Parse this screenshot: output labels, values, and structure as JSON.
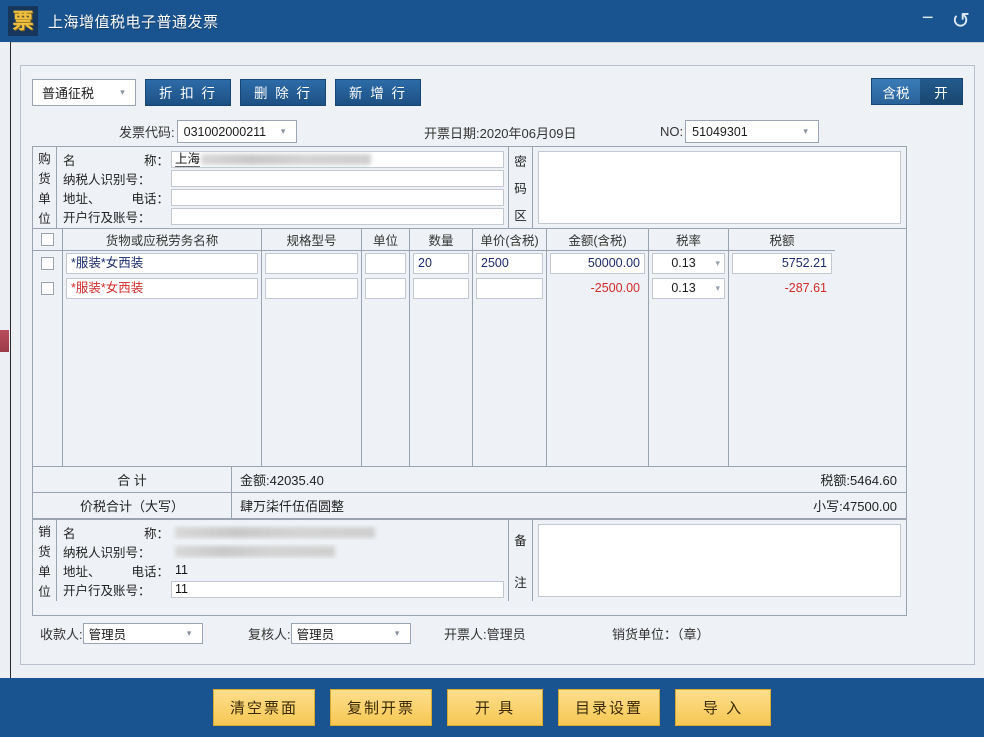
{
  "window": {
    "logo_glyph": "票",
    "title": "上海增值税电子普通发票",
    "minimize_glyph": "−",
    "restore_glyph": "↺"
  },
  "toolbar": {
    "tax_type": "普通征税",
    "caret": "▾",
    "discount_row": "折 扣 行",
    "delete_row": "删 除 行",
    "add_row": "新 增 行",
    "tax_included": "含税",
    "open": "开"
  },
  "header": {
    "code_label": "发票代码:",
    "code_value": "031002000211",
    "date_text": "开票日期:2020年06月09日",
    "no_label": "NO:",
    "no_value": "51049301"
  },
  "buyer": {
    "vertical": [
      "购",
      "货",
      "单",
      "位"
    ],
    "name_label_a": "名",
    "name_label_b": "称：",
    "name_value": "上海",
    "taxid_label": "纳税人识别号：",
    "taxid_value": "",
    "addr_label_a": "地址、",
    "addr_label_b": "电话：",
    "addr_value": "",
    "bank_label": "开户行及账号：",
    "bank_value": "",
    "secret_vertical": [
      "密",
      "码",
      "区"
    ],
    "secret_value": ""
  },
  "items": {
    "columns": [
      "货物或应税劳务名称",
      "规格型号",
      "单位",
      "数量",
      "单价(含税)",
      "金额(含税)",
      "税率",
      "税额"
    ],
    "rows": [
      {
        "name": "*服装*女西装",
        "spec": "",
        "unit": "",
        "qty": "20",
        "price": "2500",
        "amount": "50000.00",
        "rate": "0.13",
        "tax": "5752.21",
        "negative": false
      },
      {
        "name": "*服装*女西装",
        "spec": "",
        "unit": "",
        "qty": "",
        "price": "",
        "amount": "-2500.00",
        "rate": "0.13",
        "tax": "-287.61",
        "negative": true
      }
    ]
  },
  "totals": {
    "sum_label": "合    计",
    "sum_amount": "金额:42035.40",
    "sum_tax": "税额:5464.60",
    "grand_label": "价税合计（大写）",
    "grand_words": "肆万柒仟伍佰圆整",
    "grand_digits": "小写:47500.00"
  },
  "seller": {
    "vertical": [
      "销",
      "货",
      "单",
      "位"
    ],
    "name_label_a": "名",
    "name_label_b": "称：",
    "name_value": "",
    "taxid_label": "纳税人识别号：",
    "taxid_value": "",
    "addr_label_a": "地址、",
    "addr_label_b": "电话：",
    "addr_value": "11",
    "bank_label": "开户行及账号：",
    "bank_value": "11",
    "remark_vertical": [
      "备",
      "注"
    ],
    "remark_value": ""
  },
  "persons": {
    "payee_label": "收款人:",
    "payee_value": "管理员",
    "reviewer_label": "复核人:",
    "reviewer_value": "管理员",
    "drawer_text": "开票人:管理员",
    "seller_seal_text": "销货单位：（章）"
  },
  "actions": {
    "clear": "清空票面",
    "copy": "复制开票",
    "issue": "开  具",
    "catalog": "目录设置",
    "import": "导  入"
  },
  "colors": {
    "brand_blue": "#1a5490",
    "gold": "#f5c753",
    "negative_red": "#d02a2a",
    "value_navy": "#1a2a6c"
  }
}
